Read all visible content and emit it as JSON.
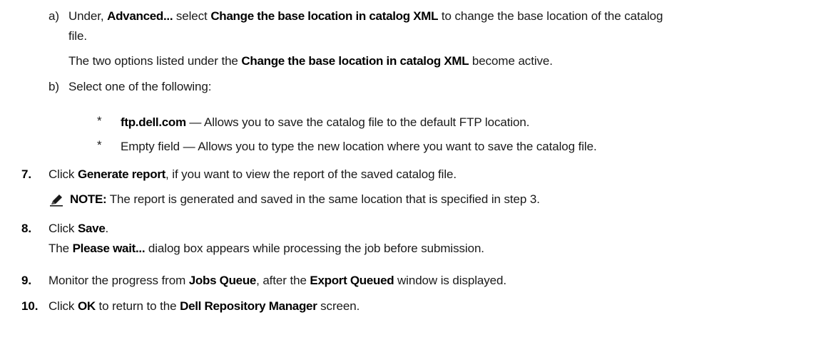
{
  "steps": {
    "substep_a": {
      "marker": "a)",
      "p1": "Under, ",
      "b1": "Advanced...",
      "p2": " select ",
      "b2": "Change the base location in catalog XML",
      "p3": " to change the base location of the catalog",
      "cont": "file.",
      "after_p1": "The two options listed under the ",
      "after_b1": "Change the base location in catalog XML",
      "after_p2": " become active."
    },
    "substep_b": {
      "marker": "b)",
      "text": "Select one of the following:",
      "options": [
        {
          "marker": "*",
          "bold": "ftp.dell.com",
          "text": " — Allows you to save the catalog file to the default FTP location."
        },
        {
          "marker": "*",
          "bold": "",
          "text": "Empty field — Allows you to type the new location where you want to save the catalog file."
        }
      ]
    },
    "step7": {
      "number": "7.",
      "p1": "Click ",
      "b1": "Generate report",
      "p2": ", if you want to view the report of the saved catalog file.",
      "note_label": "NOTE:",
      "note_text": " The report is generated and saved in the same location that is specified in step 3."
    },
    "step8": {
      "number": "8.",
      "p1": "Click ",
      "b1": "Save",
      "p2": ".",
      "sub_p1": "The ",
      "sub_b1": "Please wait...",
      "sub_p2": " dialog box appears while processing the job before submission."
    },
    "step9": {
      "number": "9.",
      "p1": "Monitor the progress from ",
      "b1": "Jobs Queue",
      "p2": ", after the ",
      "b2": "Export Queued",
      "p3": " window is displayed."
    },
    "step10": {
      "number": "10.",
      "p1": "Click ",
      "b1": "OK",
      "p2": " to return to the ",
      "b2": "Dell Repository Manager",
      "p3": " screen."
    }
  }
}
